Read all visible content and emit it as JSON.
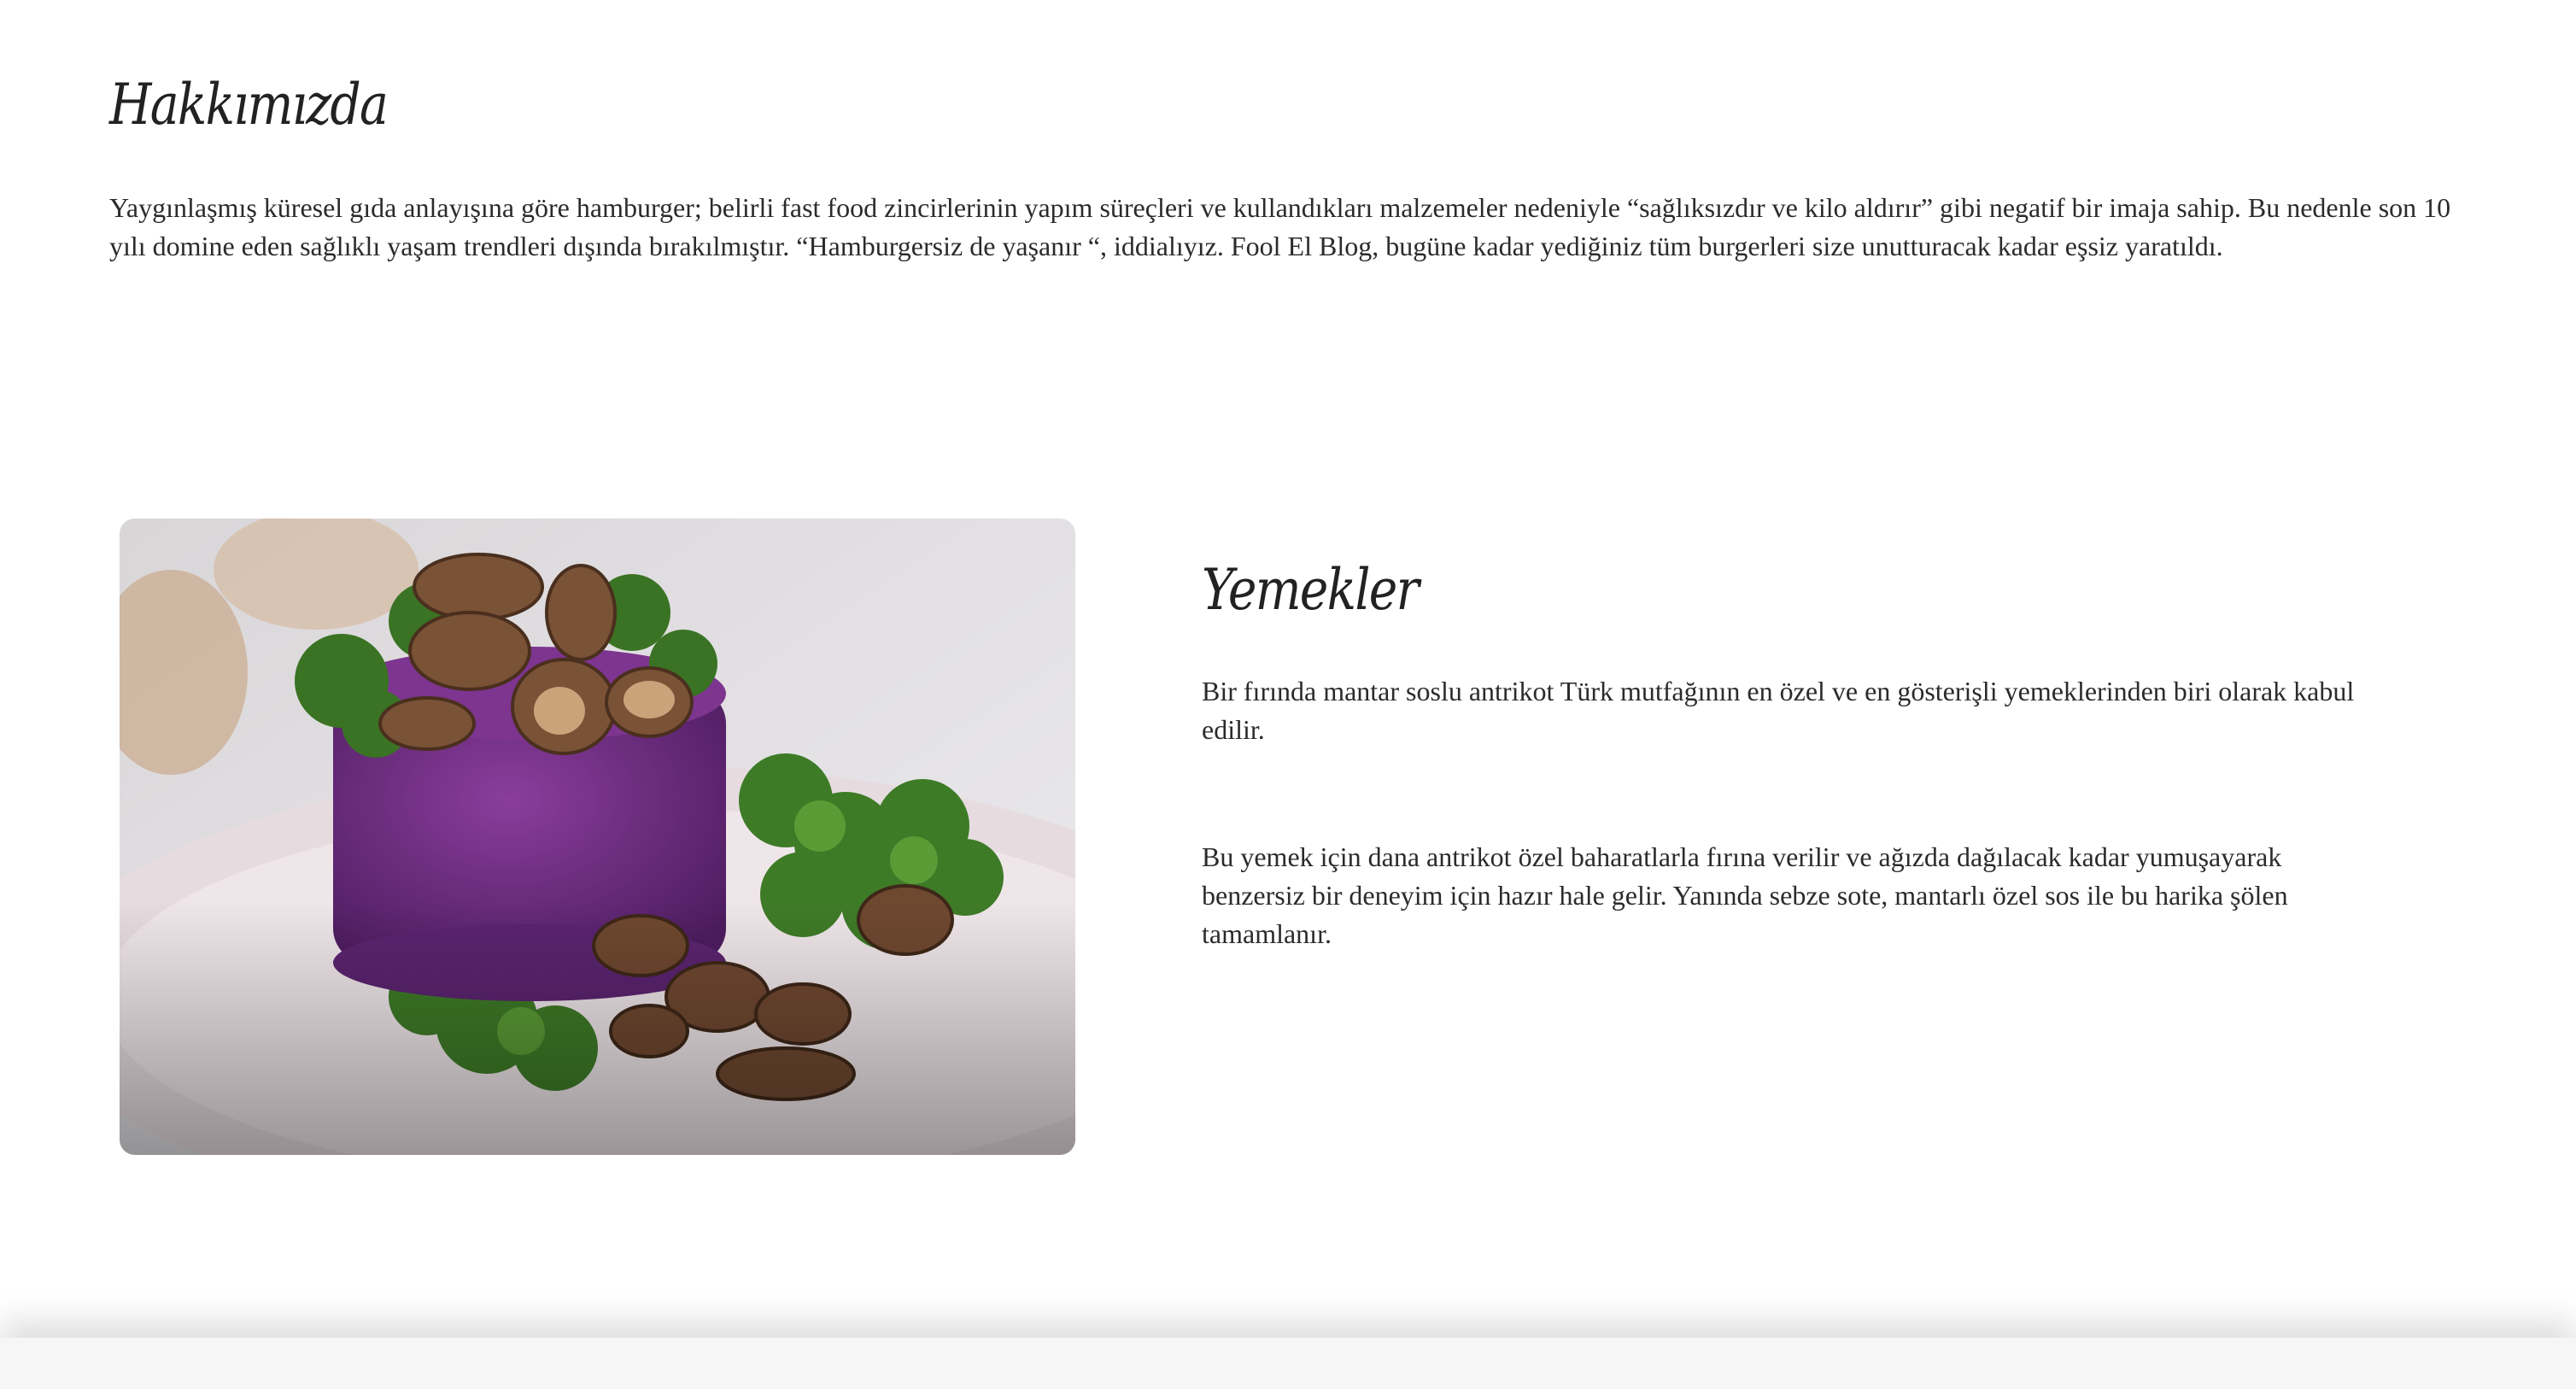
{
  "about": {
    "title": "Hakkımızda",
    "text": "Yaygınlaşmış küresel gıda anlayışına göre hamburger; belirli fast food zincirlerinin yapım süreçleri ve kullandıkları malzemeler nedeniyle “sağlıksızdır ve kilo aldırır” gibi negatif bir imaja sahip. Bu nedenle son 10 yılı domine eden sağlıklı yaşam trendleri dışında bırakılmıştır. “Hamburgersiz de yaşanır “, iddialıyız. Fool El Blog, bugüne kadar yediğiniz tüm burgerleri size unutturacak kadar eşsiz yaratıldı."
  },
  "menu": {
    "title": "Yemekler",
    "paragraph1": "Bir fırında mantar soslu antrikot Türk mutfağının en özel ve en gösterişli yemeklerinden biri olarak kabul edilir.",
    "paragraph2": "Bu yemek için dana antrikot özel baharatlarla fırına verilir ve ağızda dağılacak kadar yumuşayarak benzersiz bir deneyim için hazır hale gelir. Yanında sebze sote, mantarlı özel sos ile bu harika şölen tamamlanır."
  },
  "colors": {
    "text": "#2b2b2b",
    "background": "#ffffff",
    "purple_puree": "#6b2f7d",
    "kale_green": "#3f7a2a",
    "mushroom_brown": "#7a5236",
    "plate": "#e8dfe3"
  }
}
